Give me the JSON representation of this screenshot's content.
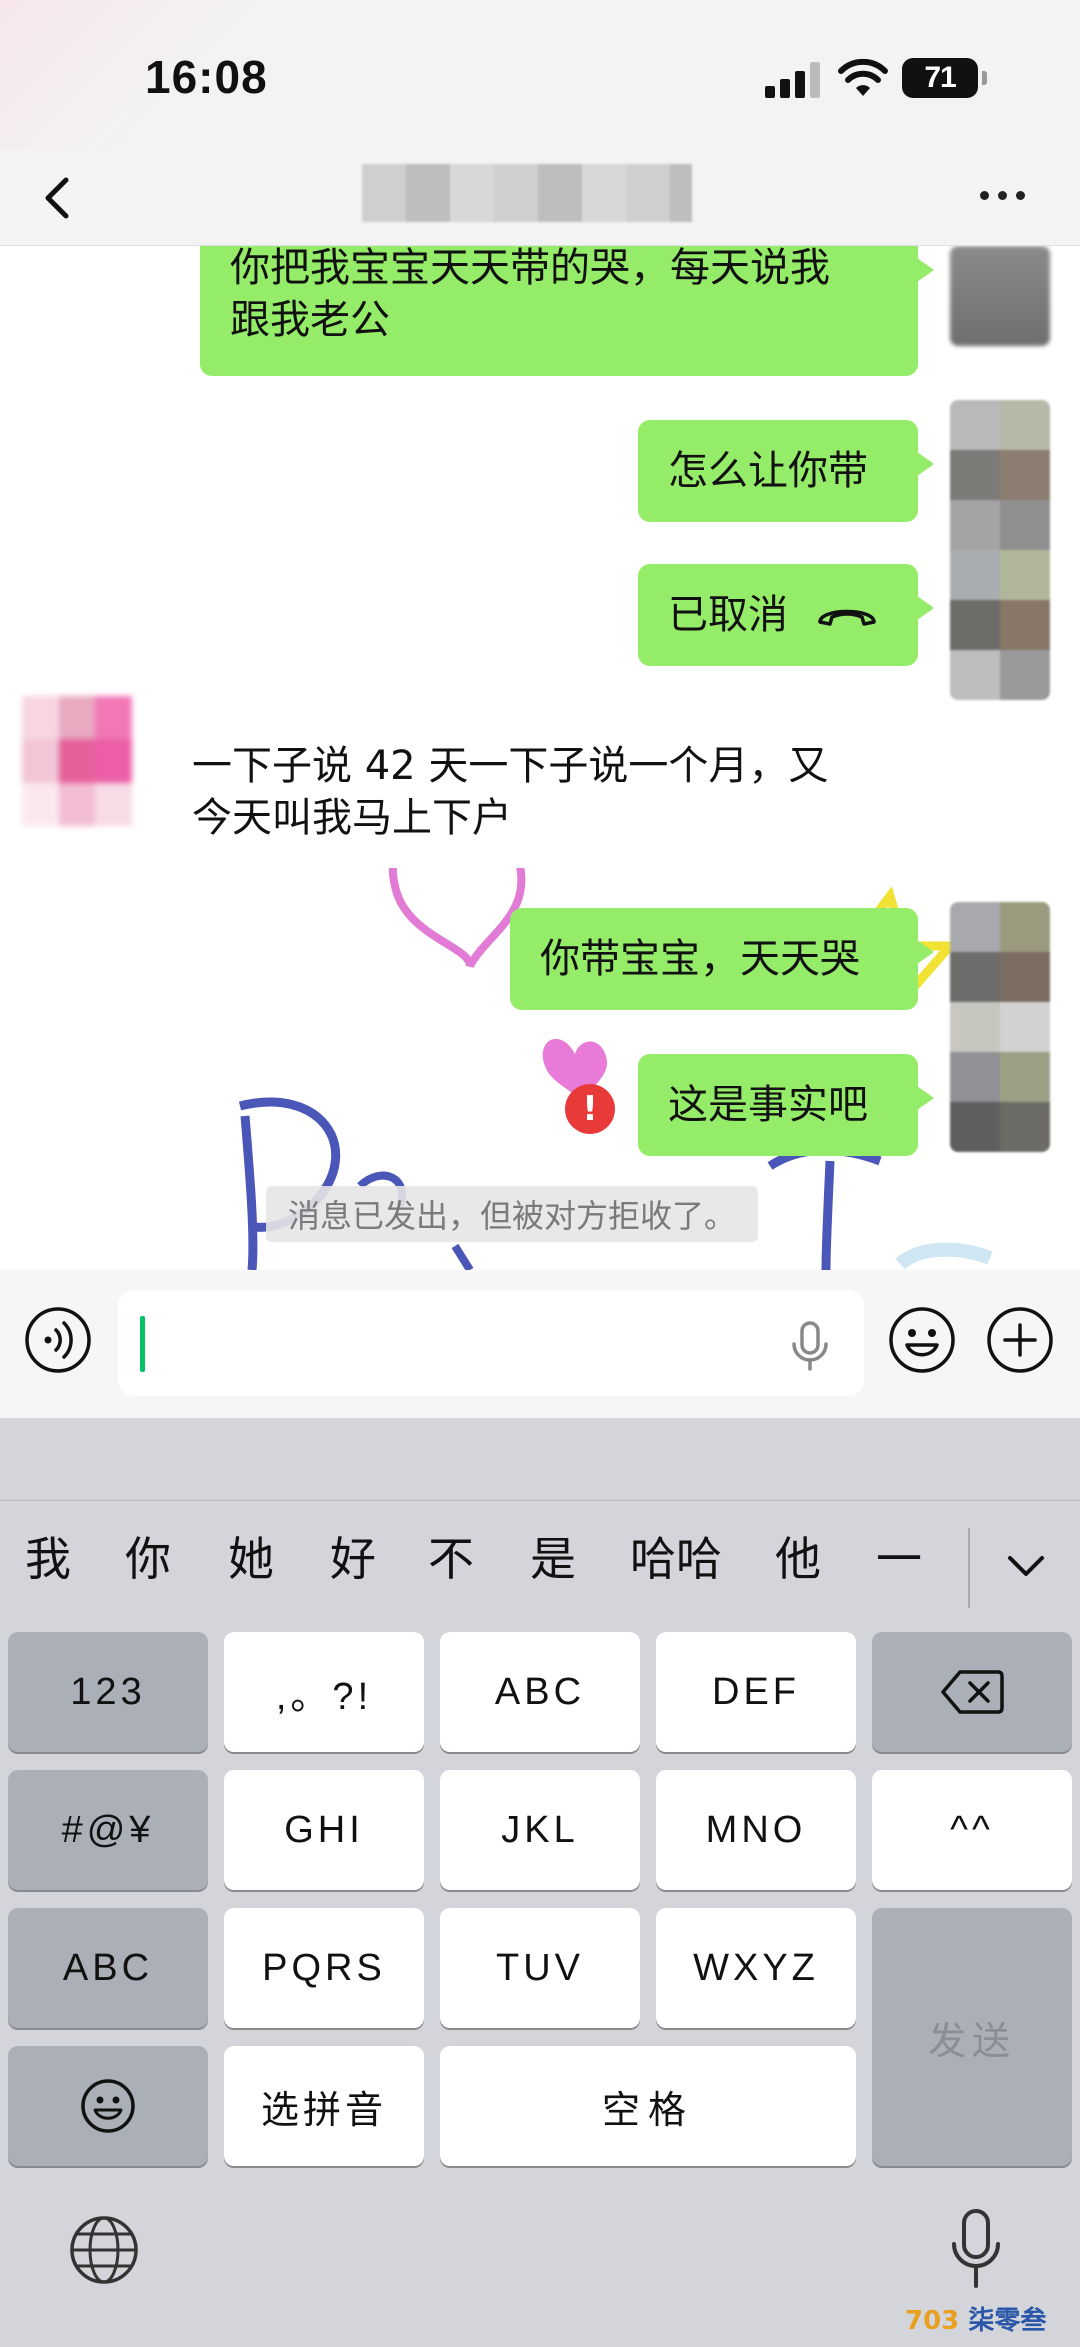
{
  "status_bar": {
    "time": "16:08",
    "battery": "71"
  },
  "nav": {
    "back_icon": "chevron-left-icon",
    "more_icon": "more-dots-icon"
  },
  "messages": [
    {
      "side": "me",
      "text_lines": [
        "你把我宝宝天天带的哭，每天说我",
        "跟我老公"
      ]
    },
    {
      "side": "me",
      "text": "怎么让你带"
    },
    {
      "side": "me",
      "text": "已取消",
      "icon": "hangup-phone-icon"
    },
    {
      "side": "them",
      "text_lines": [
        "一下子说 42 天一下子说一个月，又",
        "今天叫我马上下户"
      ]
    },
    {
      "side": "me",
      "text": "你带宝宝，天天哭"
    },
    {
      "side": "me",
      "text": "这是事实吧",
      "status": "failed"
    }
  ],
  "system_message": "消息已发出，但被对方拒收了。",
  "input_bar": {
    "value": "",
    "voice_icon": "voice-toggle-icon",
    "emoji_icon": "emoji-icon",
    "plus_icon": "plus-icon",
    "mic_icon": "microphone-icon"
  },
  "keyboard": {
    "candidates": [
      "我",
      "你",
      "她",
      "好",
      "不",
      "是",
      "哈哈",
      "他",
      "一"
    ],
    "rows": [
      [
        "123",
        ",。?!",
        "ABC",
        "DEF"
      ],
      [
        "#@¥",
        "GHI",
        "JKL",
        "MNO",
        "^^"
      ],
      [
        "ABC",
        "PQRS",
        "TUV",
        "WXYZ"
      ],
      [
        "选拼音",
        "空格"
      ]
    ],
    "send": "发送",
    "backspace_icon": "backspace-icon",
    "emoji_key_icon": "emoji-key-icon",
    "globe_icon": "globe-icon",
    "dictation_icon": "microphone-icon"
  },
  "watermark": "柒零叁"
}
